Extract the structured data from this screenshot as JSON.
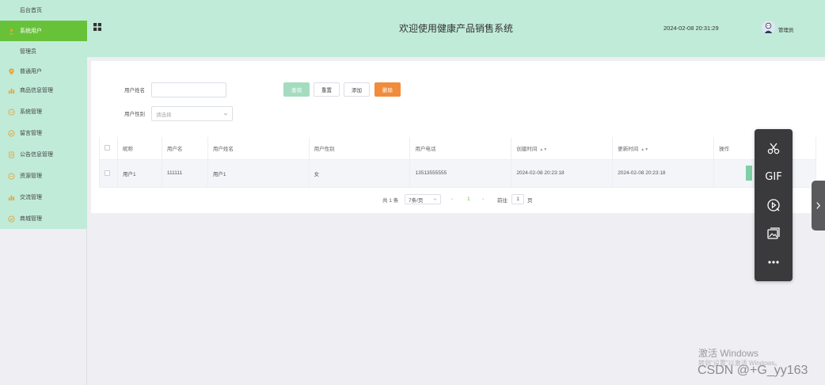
{
  "sidebar": {
    "items": [
      {
        "label": "后台首页",
        "icon": "none",
        "type": "sub"
      },
      {
        "label": "系统用户",
        "icon": "user-icon",
        "type": "group",
        "active": true
      },
      {
        "label": "管理员",
        "icon": "none",
        "type": "sub"
      },
      {
        "label": "普通用户",
        "icon": "location-pin-icon",
        "type": "group"
      },
      {
        "label": "商品信息管理",
        "icon": "bar-chart-icon",
        "type": "group"
      },
      {
        "label": "系统管理",
        "icon": "chat-icon",
        "type": "group"
      },
      {
        "label": "留言管理",
        "icon": "check-circle-icon",
        "type": "group"
      },
      {
        "label": "公告信息管理",
        "icon": "document-icon",
        "type": "group"
      },
      {
        "label": "资源管理",
        "icon": "chat-icon",
        "type": "group"
      },
      {
        "label": "交流管理",
        "icon": "bar-chart-icon",
        "type": "group"
      },
      {
        "label": "商城管理",
        "icon": "check-circle-icon",
        "type": "group"
      }
    ]
  },
  "header": {
    "title": "欢迎使用健康产品销售系统",
    "datetime": "2024-02-08 20:31:29",
    "user": "管理员"
  },
  "filters": {
    "name_label": "用户姓名",
    "name_value": "",
    "gender_label": "用户性别",
    "gender_placeholder": "请选择"
  },
  "buttons": {
    "search": "查询",
    "reset": "重置",
    "add": "添加",
    "delete": "删除"
  },
  "table": {
    "headers": [
      "昵称",
      "用户名",
      "用户姓名",
      "用户性别",
      "用户电话",
      "创建时间",
      "更新时间",
      "操作"
    ],
    "rows": [
      [
        "用户1",
        "111111",
        "用户1",
        "女",
        "13513555555",
        "2024-02-08 20:23:18",
        "2024-02-08 20:23:18",
        ""
      ]
    ]
  },
  "pagination": {
    "total_text": "共 1 条",
    "page_size": "7条/页",
    "prev": "‹",
    "current_page": "1",
    "next": "›",
    "goto_label": "前往",
    "goto_value": "1",
    "page_suffix": "页"
  },
  "tools": [
    "scissors-icon",
    "GIF",
    "record-icon",
    "image-icon",
    "more-icon"
  ],
  "watermark": {
    "windows_line1": "激活 Windows",
    "windows_line2": "转到\"设置\"以激活 Windows。",
    "csdn": "CSDN @+G_yy163"
  },
  "colors": {
    "accent": "#67c23a",
    "header_bg": "#c0ebd8",
    "delete": "#f18c3b"
  }
}
